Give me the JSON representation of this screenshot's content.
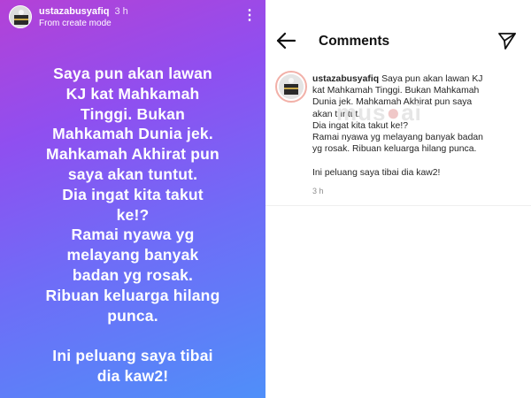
{
  "story": {
    "username": "ustazabusyafiq",
    "time": "3 h",
    "subtitle": "From create mode",
    "text": "Saya pun akan lawan\nKJ kat Mahkamah\nTinggi. Bukan\nMahkamah Dunia jek.\nMahkamah Akhirat pun\nsaya akan tuntut.\nDia ingat kita takut\nke!?\nRamai nyawa yg\nmelayang banyak\nbadan yg rosak.\nRibuan keluarga hilang\npunca.\n\nIni peluang saya tibai\ndia kaw2!",
    "more_icon": "more-vertical-icon"
  },
  "comments": {
    "title": "Comments",
    "back_icon": "arrow-left-icon",
    "send_icon": "send-icon",
    "items": [
      {
        "username": "ustazabusyafiq",
        "text": "Saya pun akan lawan KJ\nkat Mahkamah Tinggi. Bukan  Mahkamah\nDunia jek. Mahkamah Akhirat pun saya\nakan tuntut.\nDia ingat kita takut ke!?\nRamai nyawa yg melayang banyak badan\nyg rosak. Ribuan keluarga hilang punca.\n\nIni peluang saya tibai dia kaw2!",
        "time": "3 h"
      }
    ]
  },
  "watermark": "mus ai"
}
